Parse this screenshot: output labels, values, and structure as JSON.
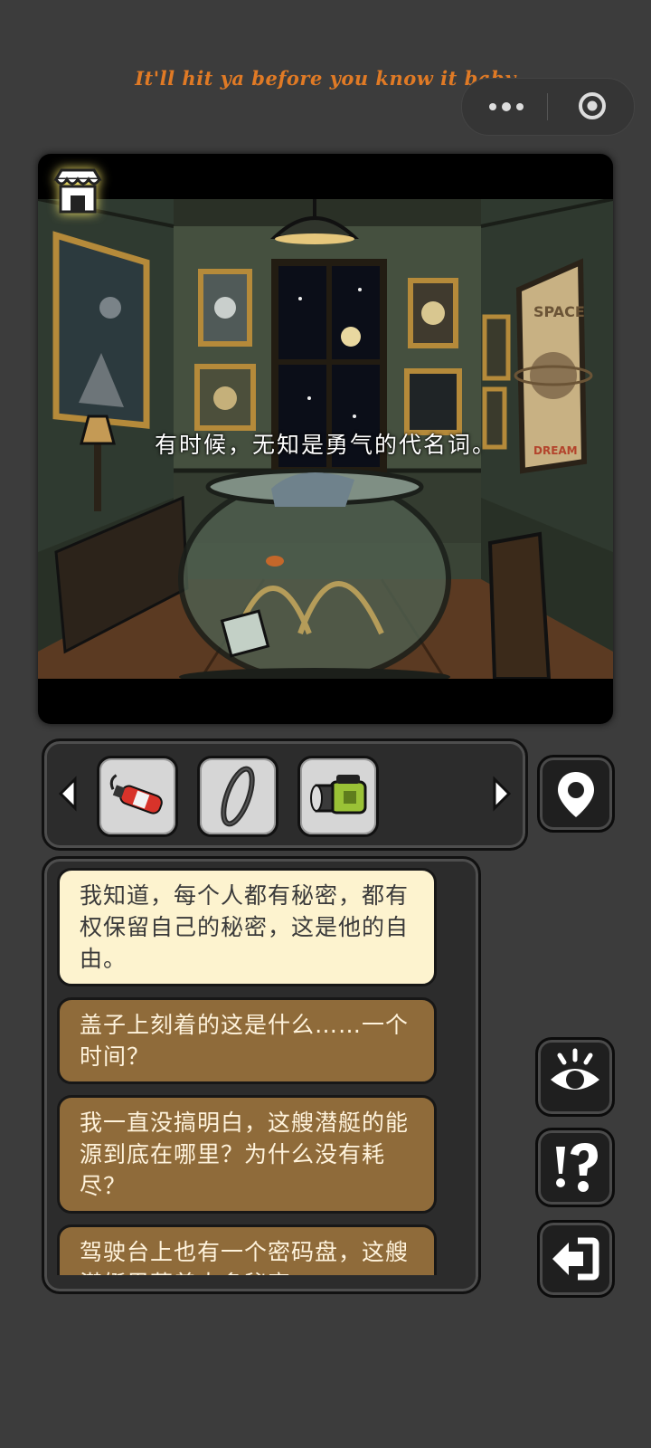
{
  "top": {
    "lyric": "It'll hit ya before you know it baby"
  },
  "capsule": {
    "more_icon": "more-dots-icon",
    "close_icon": "target-circle-icon"
  },
  "scene": {
    "caption": "有时候，无知是勇气的代名词。",
    "store_icon": "store-icon",
    "poster_top": "SPACE",
    "poster_bottom": "DREAM"
  },
  "inventory": {
    "items": [
      {
        "name": "fire-extinguisher-icon"
      },
      {
        "name": "ring-icon"
      },
      {
        "name": "flashlight-icon"
      }
    ]
  },
  "side_buttons": {
    "map": "map-pin-icon",
    "look": "eye-icon",
    "hint": "exclaim-question-icon",
    "back": "exit-arrow-icon"
  },
  "dialogue": {
    "lines": [
      {
        "text": "我知道，每个人都有秘密，都有权保留自己的秘密，这是他的自由。",
        "state": "selected"
      },
      {
        "text": "盖子上刻着的这是什么……一个时间？",
        "state": "option"
      },
      {
        "text": "我一直没搞明白，这艘潜艇的能源到底在哪里？为什么没有耗尽？",
        "state": "option"
      },
      {
        "text": "驾驶台上也有一个密码盘，这艘潜艇里藏着太多秘密。",
        "state": "option"
      }
    ]
  },
  "colors": {
    "background": "#3c3c3c",
    "lyric": "#e07a25",
    "dialog_selected": "#fdf3cf",
    "dialog_option": "#8f6b3a"
  }
}
